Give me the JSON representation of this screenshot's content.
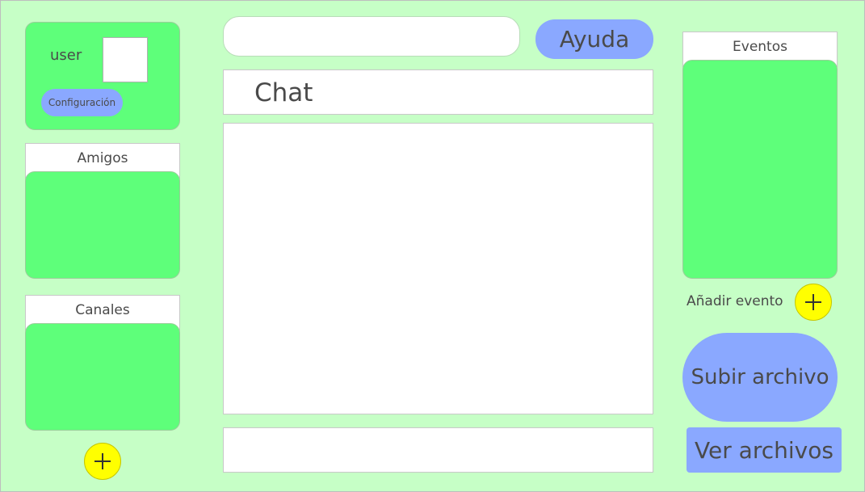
{
  "user_card": {
    "username": "user",
    "settings_label": "Configuración"
  },
  "friends_panel": {
    "title": "Amigos"
  },
  "channels_panel": {
    "title": "Canales",
    "add_icon": "plus-icon"
  },
  "search": {
    "value": "",
    "placeholder": ""
  },
  "help_button": {
    "label": "Ayuda"
  },
  "chat": {
    "title": "Chat",
    "message_input_value": ""
  },
  "events_panel": {
    "title": "Eventos",
    "add_label": "Añadir evento",
    "add_icon": "plus-icon"
  },
  "files": {
    "upload_label": "Subir archivo",
    "view_label": "Ver archivos"
  },
  "colors": {
    "background": "#c6ffc6",
    "panel_green": "#5eff7a",
    "button_blue": "#8aa8ff",
    "add_yellow": "#ffff00"
  }
}
